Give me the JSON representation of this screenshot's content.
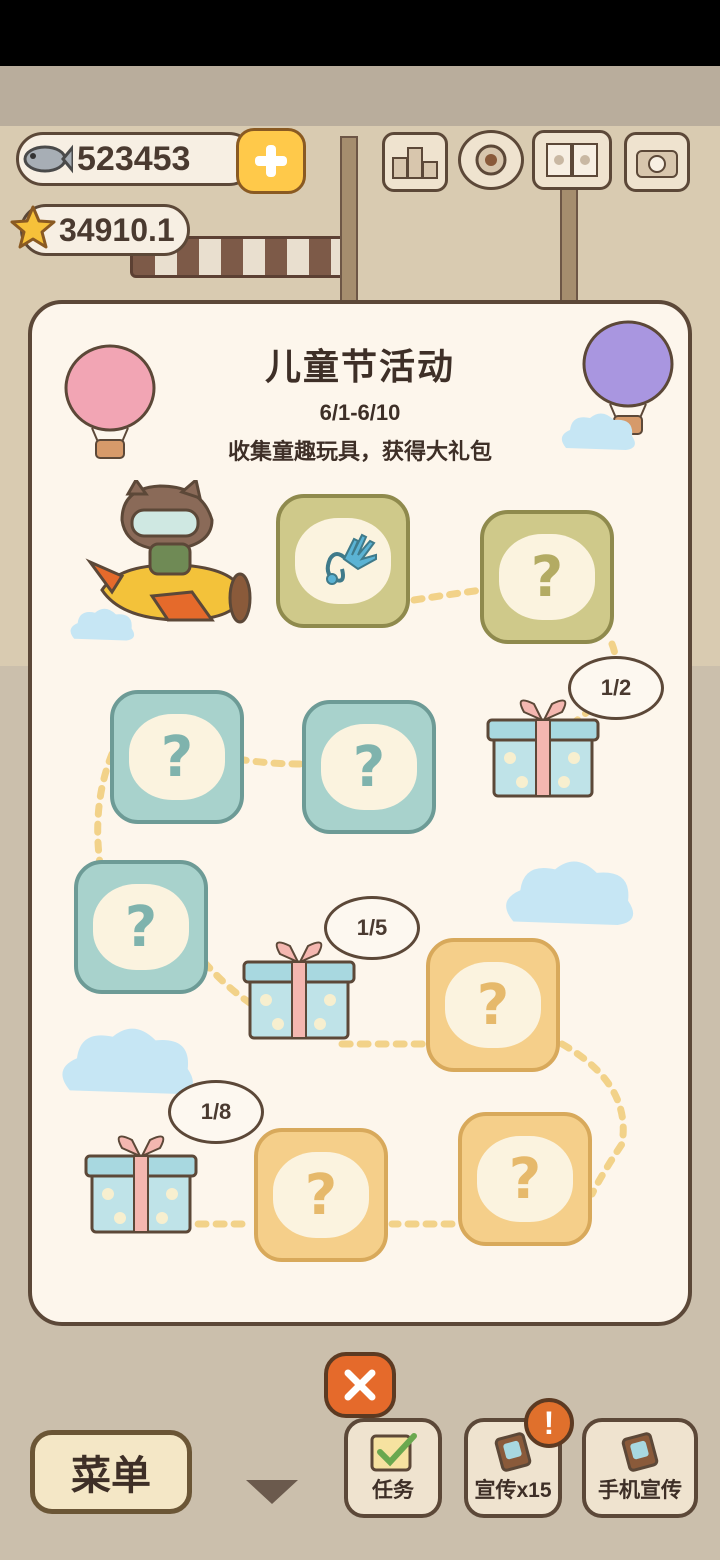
{
  "currency": {
    "fish_count": "523453",
    "star_count": "34910.1"
  },
  "event": {
    "title": "儿童节活动",
    "date_range": "6/1-6/10",
    "description": "收集童趣玩具，获得大礼包"
  },
  "nodes": [
    {
      "id": "toy-1",
      "state": "collected",
      "icon": "toy-hand-icon"
    },
    {
      "id": "toy-2",
      "state": "locked",
      "label": "?"
    },
    {
      "id": "toy-3",
      "state": "locked",
      "label": "?"
    },
    {
      "id": "toy-4",
      "state": "locked",
      "label": "?"
    },
    {
      "id": "toy-5",
      "state": "locked",
      "label": "?"
    },
    {
      "id": "toy-6",
      "state": "locked",
      "label": "?"
    },
    {
      "id": "toy-7",
      "state": "locked",
      "label": "?"
    },
    {
      "id": "toy-8",
      "state": "locked",
      "label": "?"
    }
  ],
  "gifts": [
    {
      "progress": "1/2"
    },
    {
      "progress": "1/5"
    },
    {
      "progress": "1/8"
    }
  ],
  "bottom_bar": {
    "menu_label": "菜单",
    "task_label": "任务",
    "promote_label": "宣传x15",
    "phone_promote_label": "手机宣传",
    "notification_badge": "!"
  },
  "colors": {
    "panel_bg": "#fdf6ec",
    "outline": "#5c4838",
    "close_button": "#e56a2b",
    "plus_button": "#ffc94a"
  }
}
